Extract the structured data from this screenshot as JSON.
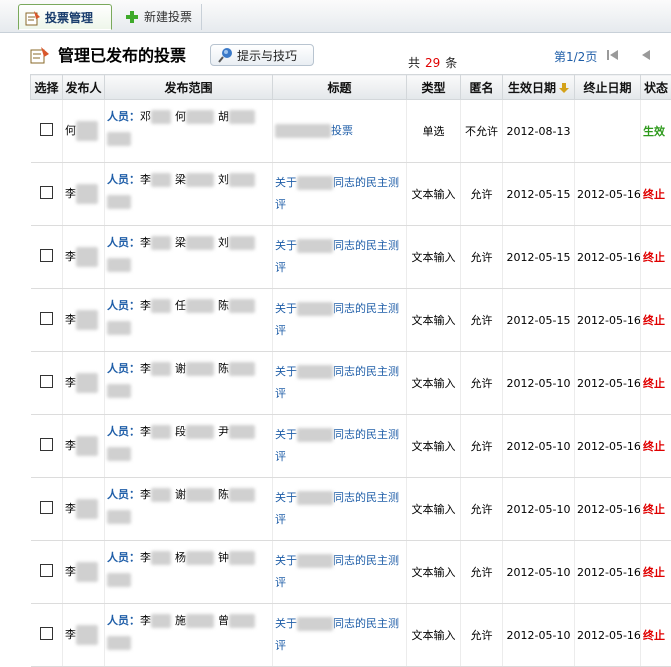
{
  "tabs": [
    {
      "label": "投票管理",
      "active": true
    },
    {
      "label": "新建投票",
      "active": false
    }
  ],
  "header": {
    "title": "管理已发布的投票",
    "tips_label": "提示与技巧",
    "total_prefix": "共",
    "total_count": "29",
    "total_suffix": "条",
    "page_info": "第1/2页"
  },
  "columns": [
    "选择",
    "发布人",
    "发布范围",
    "标题",
    "类型",
    "匿名",
    "生效日期",
    "终止日期",
    "状态"
  ],
  "scope_label": "人员：",
  "rows": [
    {
      "publisher": "何",
      "scope_names": [
        "邓",
        "何",
        "胡"
      ],
      "title_pre": "",
      "title_post": "投票",
      "type": "单选",
      "anon": "不允许",
      "start": "2012-08-13",
      "end": "",
      "status": "生效",
      "status_kind": "active"
    },
    {
      "publisher": "李",
      "scope_names": [
        "李",
        "梁",
        "刘"
      ],
      "title_pre": "关于",
      "title_post": "同志的民主测评",
      "type": "文本输入",
      "anon": "允许",
      "start": "2012-05-15",
      "end": "2012-05-16",
      "status": "终止",
      "status_kind": "ended"
    },
    {
      "publisher": "李",
      "scope_names": [
        "李",
        "梁",
        "刘"
      ],
      "title_pre": "关于",
      "title_post": "同志的民主测评",
      "type": "文本输入",
      "anon": "允许",
      "start": "2012-05-15",
      "end": "2012-05-16",
      "status": "终止",
      "status_kind": "ended"
    },
    {
      "publisher": "李",
      "scope_names": [
        "李",
        "任",
        "陈"
      ],
      "title_pre": "关于",
      "title_post": "同志的民主测评",
      "type": "文本输入",
      "anon": "允许",
      "start": "2012-05-15",
      "end": "2012-05-16",
      "status": "终止",
      "status_kind": "ended"
    },
    {
      "publisher": "李",
      "scope_names": [
        "李",
        "谢",
        "陈"
      ],
      "title_pre": "关于",
      "title_post": "同志的民主测评",
      "type": "文本输入",
      "anon": "允许",
      "start": "2012-05-10",
      "end": "2012-05-16",
      "status": "终止",
      "status_kind": "ended"
    },
    {
      "publisher": "李",
      "scope_names": [
        "李",
        "段",
        "尹"
      ],
      "title_pre": "关于",
      "title_post": "同志的民主测评",
      "type": "文本输入",
      "anon": "允许",
      "start": "2012-05-10",
      "end": "2012-05-16",
      "status": "终止",
      "status_kind": "ended"
    },
    {
      "publisher": "李",
      "scope_names": [
        "李",
        "谢",
        "陈"
      ],
      "title_pre": "关于",
      "title_post": "同志的民主测评",
      "type": "文本输入",
      "anon": "允许",
      "start": "2012-05-10",
      "end": "2012-05-16",
      "status": "终止",
      "status_kind": "ended"
    },
    {
      "publisher": "李",
      "scope_names": [
        "李",
        "杨",
        "钟"
      ],
      "title_pre": "关于",
      "title_post": "同志的民主测评",
      "type": "文本输入",
      "anon": "允许",
      "start": "2012-05-10",
      "end": "2012-05-16",
      "status": "终止",
      "status_kind": "ended"
    },
    {
      "publisher": "李",
      "scope_names": [
        "李",
        "施",
        "曾"
      ],
      "title_pre": "关于",
      "title_post": "同志的民主测评",
      "type": "文本输入",
      "anon": "允许",
      "start": "2012-05-10",
      "end": "2012-05-16",
      "status": "终止",
      "status_kind": "ended"
    }
  ],
  "colors": {
    "accent": "#1f5ea8",
    "active": "#2e9a1c",
    "ended": "#e00000",
    "count": "#e00000"
  },
  "icons": {
    "tab_manage": "edit-note-icon",
    "tab_new": "plus-icon",
    "tips": "pin-icon",
    "first_page": "first-page-icon",
    "prev_page": "prev-page-icon",
    "sort": "sort-down-icon"
  }
}
